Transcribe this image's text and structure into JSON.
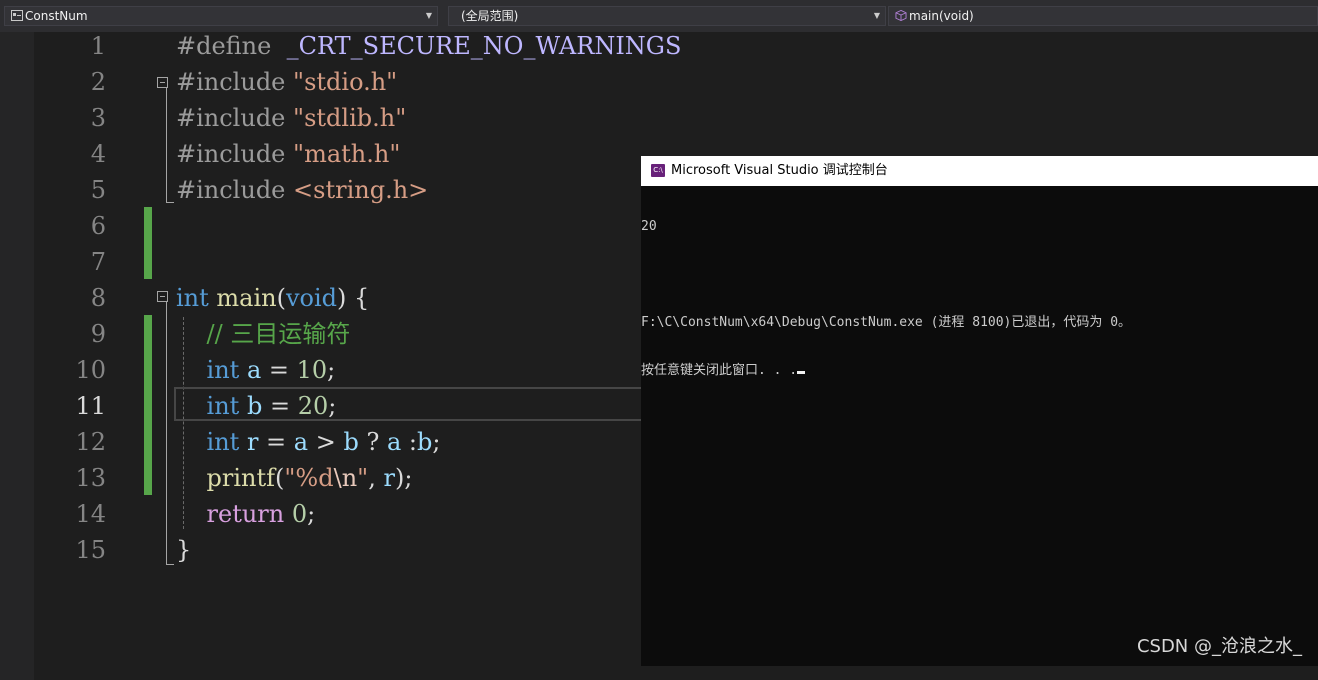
{
  "navbar": {
    "project": "ConstNum",
    "scope": "(全局范围)",
    "function": "main(void)"
  },
  "editor": {
    "current_line": 11,
    "lines": [
      {
        "n": "1"
      },
      {
        "n": "2"
      },
      {
        "n": "3"
      },
      {
        "n": "4"
      },
      {
        "n": "5"
      },
      {
        "n": "6"
      },
      {
        "n": "7"
      },
      {
        "n": "8"
      },
      {
        "n": "9"
      },
      {
        "n": "10"
      },
      {
        "n": "11"
      },
      {
        "n": "12"
      },
      {
        "n": "13"
      },
      {
        "n": "14"
      },
      {
        "n": "15"
      }
    ],
    "tokens": {
      "define": "#define",
      "define_name": "_CRT_SECURE_NO_WARNINGS",
      "include": "#include",
      "inc_stdio": "\"stdio.h\"",
      "inc_stdlib": "\"stdlib.h\"",
      "inc_math": "\"math.h\"",
      "inc_string": "<string.h>",
      "int": "int",
      "main": "main",
      "void": "void",
      "comment": "// 三目运输符",
      "var_a": "a",
      "var_b": "b",
      "var_r": "r",
      "val_a": "10",
      "val_b": "20",
      "printf": "printf",
      "fmt_open": "\"%d",
      "fmt_esc": "\\n",
      "fmt_close": "\"",
      "return": "return",
      "ret_val": "0"
    }
  },
  "console": {
    "title": "Microsoft Visual Studio 调试控制台",
    "lines": [
      "20",
      "",
      "F:\\C\\ConstNum\\x64\\Debug\\ConstNum.exe (进程 8100)已退出，代码为 0。",
      "按任意键关闭此窗口. . ."
    ]
  },
  "watermark": "CSDN @_沧浪之水_",
  "colors": {
    "keyword": "#569cd6",
    "string": "#d69d85",
    "number": "#b5cea8",
    "function": "#dcdcaa",
    "variable": "#9cdcfe",
    "comment": "#57a64a",
    "change_bar": "#57a64a"
  }
}
